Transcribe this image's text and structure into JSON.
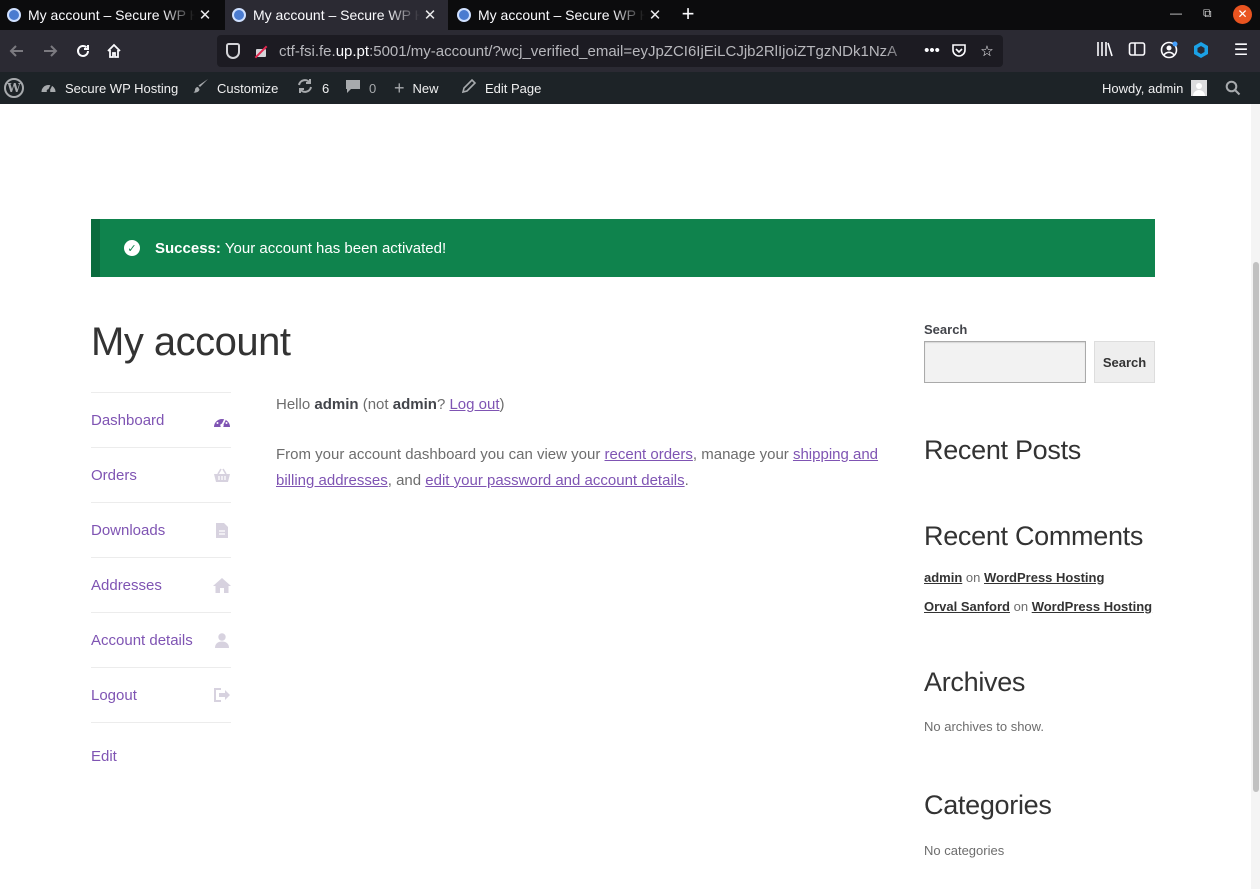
{
  "browser": {
    "tabs": [
      {
        "title": "My account – Secure WP Hosting",
        "active": false
      },
      {
        "title": "My account – Secure WP Hosting",
        "active": true
      },
      {
        "title": "My account – Secure WP Hosting",
        "active": false
      }
    ],
    "url": {
      "prefix": "ctf-fsi.fe.",
      "host": "up.pt",
      "rest": ":5001/my-account/?wcj_verified_email=eyJpZCI6IjEiLCJjb2RlIjoiZTgzNDk1NzA"
    },
    "icons": {
      "back": "arrow-left-icon",
      "forward": "arrow-right-icon",
      "reload": "reload-icon",
      "home": "home-icon",
      "library": "library-icon",
      "sidebar": "sidebar-icon",
      "account": "account-icon",
      "extension": "extension-icon",
      "menu": "hamburger-icon"
    }
  },
  "adminbar": {
    "site_name": "Secure WP Hosting",
    "customize": "Customize",
    "updates_count": "6",
    "comments_count": "0",
    "new_label": "New",
    "edit_page": "Edit Page",
    "howdy": "Howdy, admin"
  },
  "notice": {
    "strong": "Success:",
    "text": "Your account has been activated!",
    "color": "#0f834d"
  },
  "page": {
    "title": "My account",
    "hello": {
      "prefix": "Hello",
      "user": "admin",
      "not_open": "(not",
      "user2": "admin",
      "question": "?",
      "logout_link": "Log out",
      "close": ")"
    },
    "intro": {
      "t1": "From your account dashboard you can view your",
      "l1": "recent orders",
      "t2": ", manage your",
      "l2": "shipping and billing addresses",
      "t3": ", and",
      "l3": "edit your password and account details",
      "t4": "."
    }
  },
  "account_nav": [
    {
      "label": "Dashboard",
      "icon": "dashboard-icon"
    },
    {
      "label": "Orders",
      "icon": "basket-icon"
    },
    {
      "label": "Downloads",
      "icon": "file-icon"
    },
    {
      "label": "Addresses",
      "icon": "home-icon"
    },
    {
      "label": "Account details",
      "icon": "user-icon"
    },
    {
      "label": "Logout",
      "icon": "logout-icon"
    }
  ],
  "edit_link": "Edit",
  "sidebar": {
    "search_label": "Search",
    "search_button": "Search",
    "recent_posts": "Recent Posts",
    "recent_comments": "Recent Comments",
    "comments": [
      {
        "author": "admin",
        "on": "on",
        "post": "WordPress Hosting"
      },
      {
        "author": "Orval Sanford",
        "on": "on",
        "post": "WordPress Hosting"
      }
    ],
    "archives": "Archives",
    "archives_empty": "No archives to show.",
    "categories": "Categories",
    "categories_empty": "No categories"
  },
  "colors": {
    "accent": "#7f54b3",
    "admin_bar": "#1d2327",
    "success": "#0f834d"
  }
}
